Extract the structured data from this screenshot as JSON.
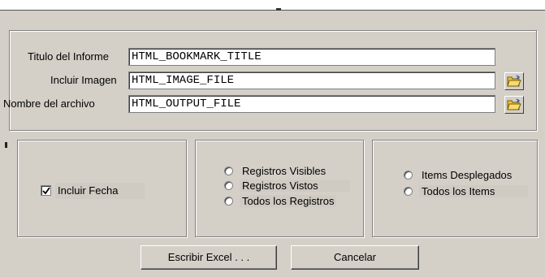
{
  "form": {
    "title_label": "Titulo del Informe",
    "title_value": "HTML_BOOKMARK_TITLE",
    "image_label": "Incluir Imagen",
    "image_value": "HTML_IMAGE_FILE",
    "file_label": "Nombre del archivo",
    "file_value": "HTML_OUTPUT_FILE"
  },
  "options": {
    "include_date_label": "Incluir Fecha",
    "include_date_checked": true,
    "records": [
      "Registros Visibles",
      "Registros Vistos",
      "Todos los Registros"
    ],
    "items": [
      "Items Desplegados",
      "Todos los Items"
    ]
  },
  "buttons": {
    "write_excel": "Escribir Excel . . .",
    "cancel": "Cancelar"
  },
  "icons": {
    "browse": "folder-open-icon",
    "checkbox": "checkmark-icon"
  }
}
